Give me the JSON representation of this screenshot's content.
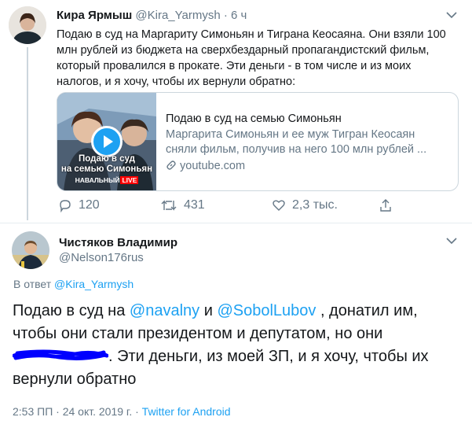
{
  "tweet1": {
    "author_name": "Кира Ярмыш",
    "handle": "@Kira_Yarmysh",
    "separator": "·",
    "time": "6 ч",
    "text": "Подаю в суд на Маргариту Симоньян и Тиграна Кеосаяна. Они взяли 100 млн рублей из бюджета на сверхбездарный пропагандистский фильм, который провалился в прокате. Эти деньги - в том числе и из моих налогов, и я хочу, чтобы их вернули обратно:",
    "card": {
      "title": "Подаю в суд на семью Симоньян",
      "description": "Маргарита Симоньян и ее муж Тигран Кеосаян сняли фильм, получив на него 100 млн рублей ...",
      "domain": "youtube.com",
      "thumb_caption_line1": "Подаю в суд",
      "thumb_caption_line2": "на семью Симоньян",
      "thumb_brand": "НАВАЛЬНЫЙ",
      "thumb_brand_live": "LIVE"
    },
    "actions": {
      "replies": "120",
      "retweets": "431",
      "likes": "2,3 тыс."
    }
  },
  "tweet2": {
    "author_name": "Чистяков Владимир",
    "handle": "@Nelson176rus",
    "reply_prefix": "В ответ",
    "reply_to": "@Kira_Yarmysh",
    "text_part1": "Подаю в суд на ",
    "mention1": "@navalny",
    "text_part2": " и ",
    "mention2": "@SobolLubov",
    "text_part3": " , донатил им, чтобы они стали президентом и депутатом, но они ",
    "text_part4": ". Эти деньги, из моей ЗП, и я хочу, чтобы их вернули обратно",
    "time": "2:53 ПП",
    "date_sep": "·",
    "date": "24 окт. 2019 г.",
    "source_sep": "·",
    "source": "Twitter for Android"
  },
  "colors": {
    "accent": "#1da1f2",
    "muted": "#657786",
    "scribble": "#0000ff",
    "youtube_red": "#ff0000"
  }
}
